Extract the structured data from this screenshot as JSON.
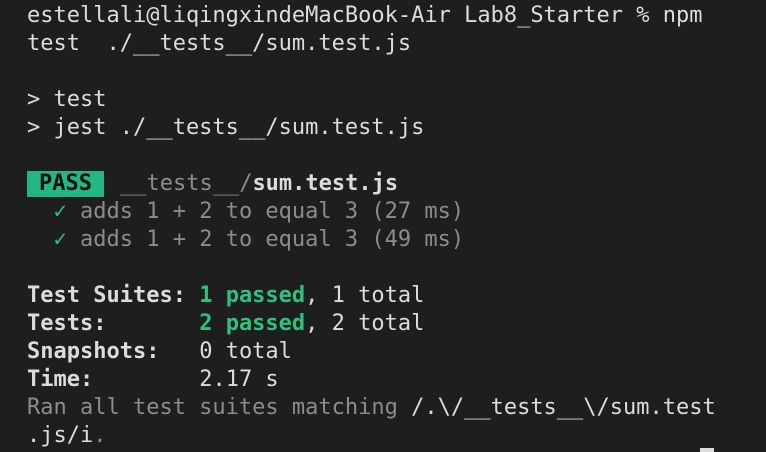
{
  "terminal": {
    "prompt_line1": "estellali@liqingxindeMacBook-Air Lab8_Starter % npm",
    "prompt_line2": "test  ./__tests__/sum.test.js",
    "script_name": "> test",
    "script_cmd": "> jest ./__tests__/sum.test.js",
    "pass_label": "PASS",
    "test_dir": "__tests__/",
    "test_file": "sum.test.js",
    "check": "✓",
    "tests": [
      {
        "text": "adds 1 + 2 to equal 3 (27 ms)"
      },
      {
        "text": "adds 1 + 2 to equal 3 (49 ms)"
      }
    ],
    "summary": {
      "suites_label": "Test Suites:",
      "suites_passed": "1 passed",
      "suites_total": ", 1 total",
      "tests_label": "Tests:",
      "tests_passed": "2 passed",
      "tests_total": ", 2 total",
      "snapshots_label": "Snapshots:",
      "snapshots_value": "0 total",
      "time_label": "Time:",
      "time_value": "2.17 s"
    },
    "ran_prefix": "Ran all test suites matching ",
    "ran_pattern_1": "/.\\/__tests__\\/sum.test",
    "ran_pattern_2": ".js/i",
    "ran_suffix": "."
  },
  "colors": {
    "background": "#1e1e1e",
    "pass_badge": "#23b784",
    "passed_text": "#2ec27e",
    "dim_text": "#8c8c8c"
  }
}
